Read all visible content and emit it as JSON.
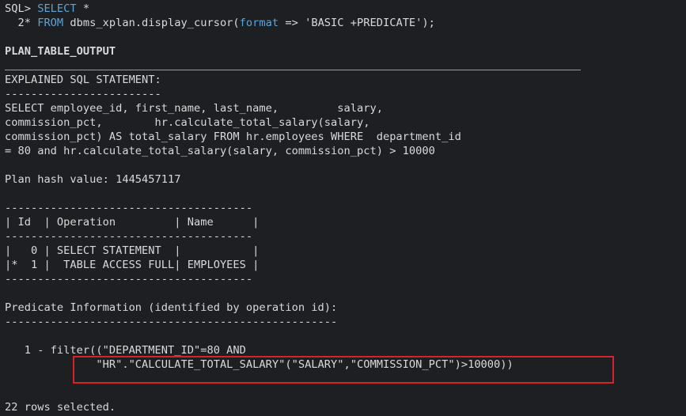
{
  "terminal": {
    "prompt_line": {
      "prompt": "SQL> ",
      "kw_select": "SELECT",
      "rest": " *"
    },
    "second_line": {
      "lead": "  2* ",
      "kw_from": "FROM",
      "mid": " dbms_xplan.display_cursor(",
      "kw_format": "format",
      "rest": " => 'BASIC +PREDICATE');"
    },
    "lines": [
      "PLAN_TABLE_OUTPUT",
      "EXPLAINED SQL STATEMENT:",
      "------------------------",
      "SELECT employee_id, first_name, last_name,         salary,",
      "commission_pct,        hr.calculate_total_salary(salary,",
      "commission_pct) AS total_salary FROM hr.employees WHERE  department_id",
      "= 80 and hr.calculate_total_salary(salary, commission_pct) > 10000",
      "Plan hash value: 1445457117",
      "--------------------------------------",
      "| Id  | Operation         | Name      |",
      "--------------------------------------",
      "|   0 | SELECT STATEMENT  |           |",
      "|*  1 |  TABLE ACCESS FULL| EMPLOYEES |",
      "--------------------------------------",
      "Predicate Information (identified by operation id):",
      "---------------------------------------------------",
      "   1 - filter((\"DEPARTMENT_ID\"=80 AND",
      "              \"HR\".\"CALCULATE_TOTAL_SALARY\"(\"SALARY\",\"COMMISSION_PCT\")>10000))",
      "22 rows selected."
    ],
    "colors": {
      "background": "#1e1f23",
      "text": "#d9d9d9",
      "keyword": "#5aa5d8",
      "highlight": "#d6232b"
    }
  }
}
